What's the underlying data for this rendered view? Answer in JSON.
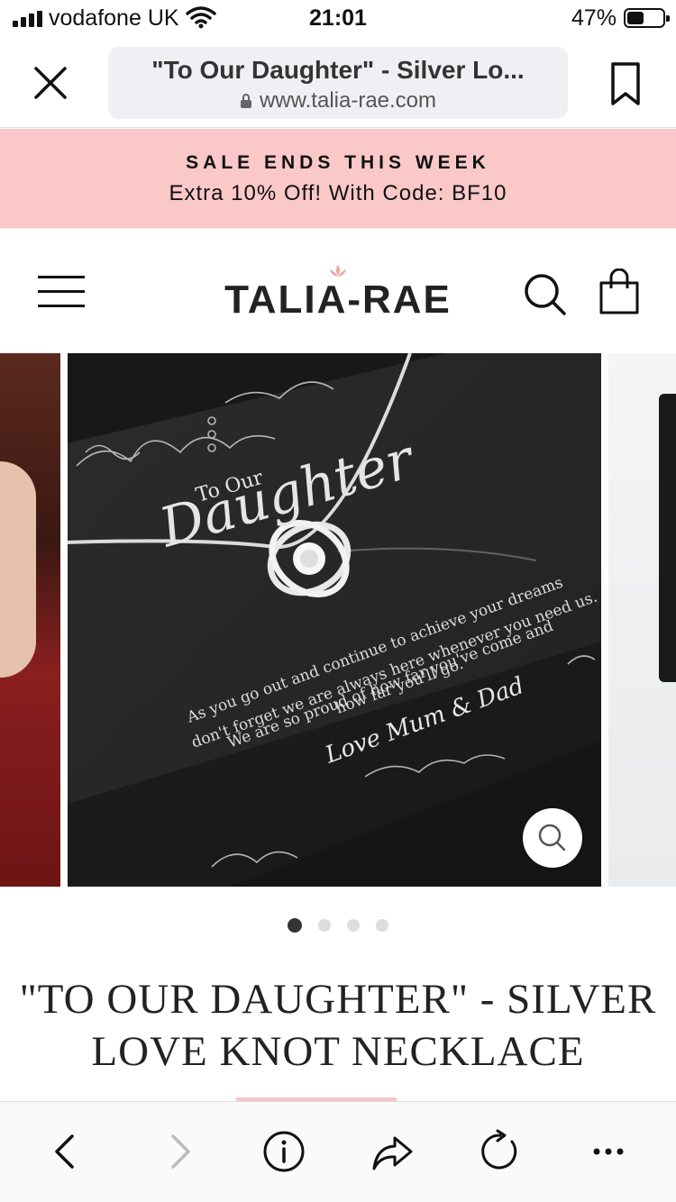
{
  "status_bar": {
    "carrier": "vodafone UK",
    "time": "21:01",
    "battery_percent": "47%"
  },
  "browser": {
    "page_title": "\"To Our Daughter\" - Silver Lo...",
    "domain": "www.talia-rae.com"
  },
  "promo": {
    "title": "SALE ENDS THIS WEEK",
    "subtitle": "Extra 10% Off! With Code: BF10"
  },
  "header": {
    "logo": "TALIA-RAE"
  },
  "carousel": {
    "current_slide": 1,
    "total_slides": 4,
    "card": {
      "heading_small": "To Our",
      "heading_script": "Daughter",
      "message_lines": [
        "As you go out and continue to achieve your dreams",
        "don't forget we are always here whenever you need us.",
        "We are so proud of how far you've come and",
        "how far you'll go."
      ],
      "signature": "Love Mum & Dad"
    }
  },
  "product": {
    "title_line1": "\"TO OUR DAUGHTER\" - SILVER",
    "title_line2": "LOVE KNOT NECKLACE"
  },
  "colors": {
    "promo_bg": "#fac8c8",
    "accent": "#f6c6c6",
    "card_bg": "#1d1d1d"
  },
  "icons": {
    "close": "close-icon",
    "bookmark": "bookmark-icon",
    "menu": "hamburger-menu-icon",
    "search": "search-icon",
    "cart": "shopping-bag-icon",
    "zoom": "zoom-icon",
    "back": "chevron-left-icon",
    "forward": "chevron-right-icon",
    "info": "info-icon",
    "share": "share-icon",
    "reload": "reload-icon",
    "more": "more-icon"
  }
}
